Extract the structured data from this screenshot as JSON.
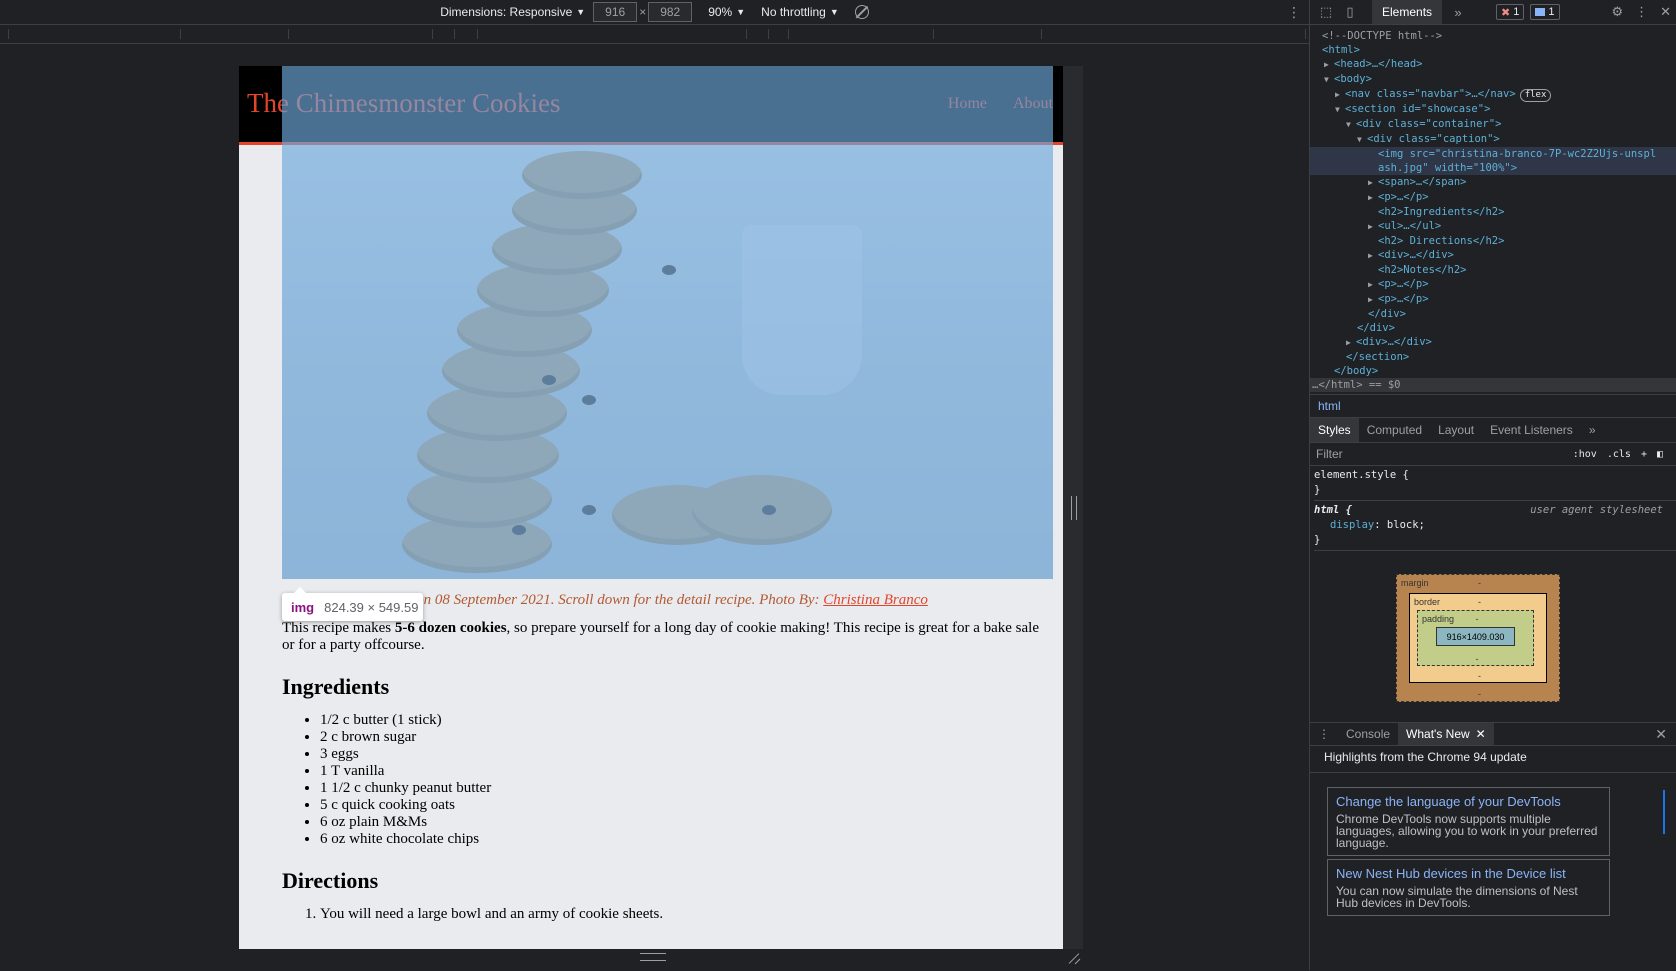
{
  "toolbar": {
    "dimensions_label": "Dimensions: Responsive",
    "width": "916",
    "height": "982",
    "zoom": "90%",
    "throttling": "No throttling"
  },
  "site": {
    "brand": "The Chimesmonster Cookies",
    "nav": [
      "Home",
      "About"
    ],
    "caption_text": "design blog, accessed on 08 September 2021. Scroll down for the detail recipe. Photo By: ",
    "caption_link": "Christina Branco",
    "intro_pre": "This recipe makes ",
    "intro_bold": "5-6 dozen cookies",
    "intro_post": ", so prepare yourself for a long day of cookie making! This recipe is great for a bake sale or for a party offcourse.",
    "ingredients_heading": "Ingredients",
    "ingredients": [
      "1/2 c butter (1 stick)",
      "2 c brown sugar",
      "3 eggs",
      "1 T vanilla",
      "1 1/2 c chunky peanut butter",
      "5 c quick cooking oats",
      "6 oz plain M&Ms",
      "6 oz white chocolate chips"
    ],
    "directions_heading": "Directions",
    "directions_first": "You will need a large bowl and an army of cookie sheets."
  },
  "tooltip": {
    "tag": "img",
    "dimensions": "824.39 × 549.59"
  },
  "devtools": {
    "tab_elements": "Elements",
    "error_count": "1",
    "message_count": "1",
    "dom": {
      "doctype": "<!--DOCTYPE html-->",
      "html_open": "<html>",
      "head": "<head>…</head>",
      "body_open": "<body>",
      "nav": "<nav class=\"navbar\">…</nav>",
      "flex_pill": "flex",
      "section_open": "<section id=\"showcase\">",
      "container_open": "<div class=\"container\">",
      "caption_open": "<div class=\"caption\">",
      "img_line1": "<img src=\"christina-branco-7P-wc2Z2Ujs-unspl",
      "img_line2": "ash.jpg\" width=\"100%\">",
      "span": "<span>…</span>",
      "p1": "<p>…</p>",
      "h2_ing": "<h2>Ingredients</h2>",
      "ul": "<ul>…</ul>",
      "h2_dir": "<h2> Directions</h2>",
      "div_inner": "<div>…</div>",
      "h2_notes": "<h2>Notes</h2>",
      "p2": "<p>…</p>",
      "p3": "<p>…</p>",
      "div_close": "</div>",
      "div_close2": "</div>",
      "div_after": "<div>…</div>",
      "section_close": "</section>",
      "body_close": "</body>",
      "html_close": "…</html> == $0"
    },
    "breadcrumb": "html",
    "subtabs": [
      "Styles",
      "Computed",
      "Layout",
      "Event Listeners"
    ],
    "filter_placeholder": "Filter",
    "hov": ":hov",
    "cls": ".cls",
    "element_style": "element.style {",
    "rule_close": "}",
    "html_selector": "html {",
    "ua_label": "user agent stylesheet",
    "prop_name": "display",
    "prop_value": "block;",
    "boxmodel": {
      "margin": "margin",
      "border": "border",
      "padding": "padding",
      "content": "916×1409.030",
      "dash": "-"
    },
    "drawer_tabs": [
      "Console",
      "What's New"
    ],
    "whats_new_title": "Highlights from the Chrome 94 update",
    "cards": [
      {
        "title": "Change the language of your DevTools",
        "desc": "Chrome DevTools now supports multiple languages, allowing you to work in your preferred language."
      },
      {
        "title": "New Nest Hub devices in the Device list",
        "desc": "You can now simulate the dimensions of Nest Hub devices in DevTools."
      }
    ]
  }
}
